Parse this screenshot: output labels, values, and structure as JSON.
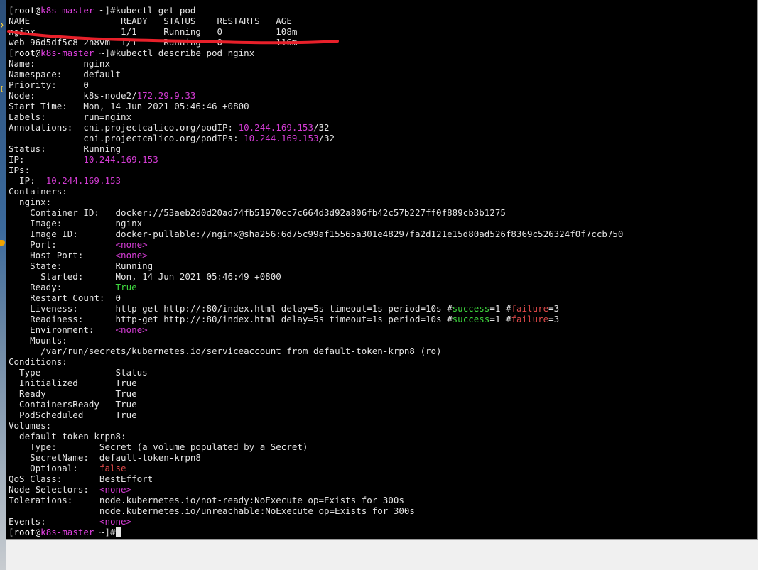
{
  "prompt": {
    "open": "[",
    "user": "root",
    "at": "@",
    "host": "k8s-master",
    "dir": " ~",
    "close": "]#"
  },
  "commands": {
    "get_pod": "kubectl get pod",
    "describe": "kubectl describe pod nginx",
    "final": ""
  },
  "pod_table": {
    "header": "NAME                 READY   STATUS    RESTARTS   AGE",
    "row_nginx": "nginx                1/1     Running   0          108m",
    "row_web": "web-96d5df5c8-2h8vm  1/1     Running   0          116m"
  },
  "describe": {
    "name": "Name:         nginx",
    "namespace": "Namespace:    default",
    "priority": "Priority:     0",
    "node_label": "Node:         k8s-node2/",
    "node_ip": "172.29.9.33",
    "start_time": "Start Time:   Mon, 14 Jun 2021 05:46:46 +0800",
    "labels": "Labels:       run=nginx",
    "annot1_label": "Annotations:  cni.projectcalico.org/podIP: ",
    "annot1_ip": "10.244.169.153",
    "annot1_suffix": "/32",
    "annot2_label": "              cni.projectcalico.org/podIPs: ",
    "annot2_ip": "10.244.169.153",
    "annot2_suffix": "/32",
    "status": "Status:       Running",
    "ip_label": "IP:           ",
    "ip_value": "10.244.169.153",
    "ips": "IPs:",
    "ips_ip_label": "  IP:  ",
    "ips_ip_value": "10.244.169.153",
    "containers": "Containers:",
    "container_name": "  nginx:",
    "container_id": "    Container ID:   docker://53aeb2d0d20ad74fb51970cc7c664d3d92a806fb42c57b227ff0f889cb3b1275",
    "image": "    Image:          nginx",
    "image_id": "    Image ID:       docker-pullable://nginx@sha256:6d75c99af15565a301e48297fa2d121e15d80ad526f8369c526324f0f7ccb750",
    "port_label": "    Port:           ",
    "port_value": "<none>",
    "host_port_label": "    Host Port:      ",
    "host_port_value": "<none>",
    "state": "    State:          Running",
    "started": "      Started:      Mon, 14 Jun 2021 05:46:49 +0800",
    "ready_label": "    Ready:          ",
    "ready_value": "True",
    "restart_count": "    Restart Count:  0",
    "liveness_prefix": "    Liveness:       http-get http://:80/index.html delay=5s timeout=1s period=10s #",
    "readiness_prefix": "    Readiness:      http-get http://:80/index.html delay=5s timeout=1s period=10s #",
    "probe_success": "success",
    "probe_success_val": "=1 #",
    "probe_failure": "failure",
    "probe_failure_val": "=3",
    "env_label": "    Environment:    ",
    "env_value": "<none>",
    "mounts": "    Mounts:",
    "mount_path": "      /var/run/secrets/kubernetes.io/serviceaccount from default-token-krpn8 (ro)",
    "conditions": "Conditions:",
    "cond_header": "  Type              Status",
    "cond_initialized": "  Initialized       True",
    "cond_ready": "  Ready             True",
    "cond_containers_ready": "  ContainersReady   True",
    "cond_pod_scheduled": "  PodScheduled      True",
    "volumes": "Volumes:",
    "volume_name": "  default-token-krpn8:",
    "vol_type": "    Type:        Secret (a volume populated by a Secret)",
    "vol_secret": "    SecretName:  default-token-krpn8",
    "vol_optional_label": "    Optional:    ",
    "vol_optional_value": "false",
    "qos": "QoS Class:       BestEffort",
    "node_selectors_label": "Node-Selectors:  ",
    "node_selectors_value": "<none>",
    "tolerations1": "Tolerations:     node.kubernetes.io/not-ready:NoExecute op=Exists for 300s",
    "tolerations2": "                 node.kubernetes.io/unreachable:NoExecute op=Exists for 300s",
    "events_label": "Events:          ",
    "events_value": "<none>"
  },
  "colors": {
    "background": "#000000",
    "text": "#e5e5e5",
    "hostname": "#e040e0",
    "ip_highlight": "#d43cd4",
    "success": "#3fd83f",
    "failure": "#e04a4a",
    "annotation_underline": "#e8202a"
  },
  "icons": [
    "sidebar-chevron-icon",
    "sidebar-status-dot-icon"
  ]
}
